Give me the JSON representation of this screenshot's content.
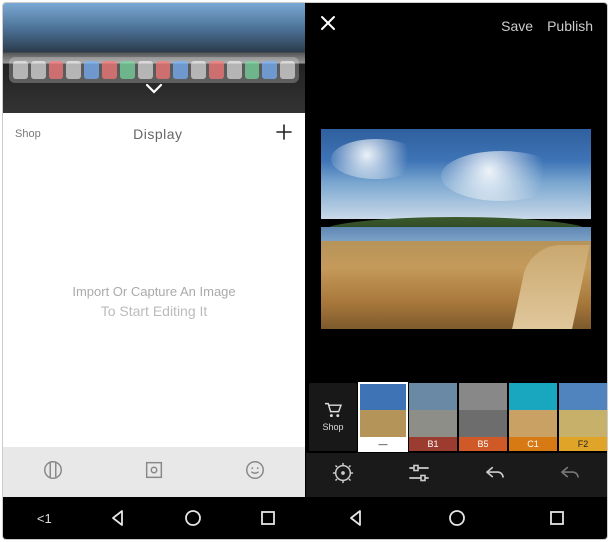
{
  "left": {
    "header": {
      "shop": "Shop",
      "title": "Display",
      "plus_icon": "plus-icon"
    },
    "empty": {
      "line1": "Import Or Capture An Image",
      "line2": "To Start Editing It"
    },
    "bottom_icons": [
      "columns-icon",
      "camera-frame-icon",
      "smiley-icon"
    ],
    "collapse_icon": "chevron-down-icon",
    "nav": {
      "less_than_one": "<1",
      "items": [
        "back-triangle-icon",
        "circle-icon",
        "square-icon"
      ]
    }
  },
  "right": {
    "header": {
      "close_icon": "close-icon",
      "save": "Save",
      "publish": "Publish"
    },
    "shop_tile": {
      "icon": "cart-icon",
      "label": "Shop"
    },
    "filters": [
      {
        "name": "—",
        "label_bg": "#ffffff",
        "label_fg": "#000000",
        "sky": "#3e74b6",
        "ground": "#b5945a",
        "selected": true
      },
      {
        "name": "B1",
        "label_bg": "#9c3b2f",
        "label_fg": "#ffffff",
        "sky": "#6a89a5",
        "ground": "#8e8e88",
        "selected": false
      },
      {
        "name": "B5",
        "label_bg": "#cf5a28",
        "label_fg": "#ffffff",
        "sky": "#888888",
        "ground": "#6d6d6d",
        "selected": false
      },
      {
        "name": "C1",
        "label_bg": "#d77a14",
        "label_fg": "#ffffff",
        "sky": "#19a7bf",
        "ground": "#caa165",
        "selected": false
      },
      {
        "name": "F2",
        "label_bg": "#e0a429",
        "label_fg": "#222222",
        "sky": "#4f84be",
        "ground": "#c7b06a",
        "selected": false
      }
    ],
    "toolbar_icons": [
      "presets-wheel-icon",
      "sliders-icon",
      "undo-icon",
      "redo-icon"
    ],
    "nav": {
      "items": [
        "back-triangle-icon",
        "circle-icon",
        "square-icon"
      ]
    }
  }
}
